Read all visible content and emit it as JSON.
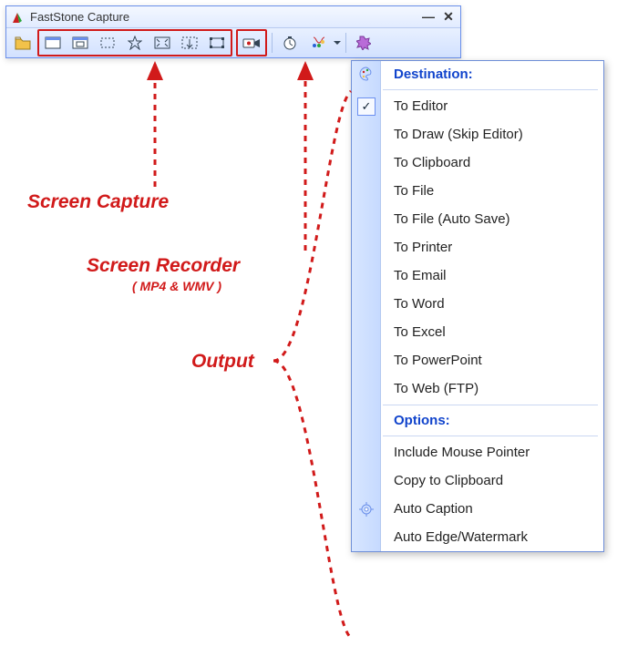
{
  "window": {
    "title": "FastStone Capture"
  },
  "toolbar": {
    "open": "Open",
    "capture_window": "Capture Active Window",
    "capture_object": "Capture Window/Object",
    "capture_rect": "Capture Rectangular Region",
    "capture_freehand": "Capture Freehand Region",
    "capture_full": "Capture Full Screen",
    "capture_scroll": "Capture Scrolling Window",
    "capture_fixed": "Capture Fixed Region",
    "recorder": "Screen Recorder",
    "delay": "Delay",
    "output": "Output",
    "settings": "Settings"
  },
  "dropdown": {
    "dest_header": "Destination:",
    "items": [
      "To Editor",
      "To Draw (Skip Editor)",
      "To Clipboard",
      "To File",
      "To File (Auto Save)",
      "To Printer",
      "To Email",
      "To Word",
      "To Excel",
      "To PowerPoint",
      "To Web (FTP)"
    ],
    "opt_header": "Options:",
    "options": [
      "Include Mouse Pointer",
      "Copy to Clipboard",
      "Auto Caption",
      "Auto Edge/Watermark"
    ],
    "checked_index": 0
  },
  "annotations": {
    "capture": "Screen Capture",
    "recorder": "Screen Recorder",
    "recorder_sub": "( MP4 & WMV )",
    "output": "Output"
  }
}
